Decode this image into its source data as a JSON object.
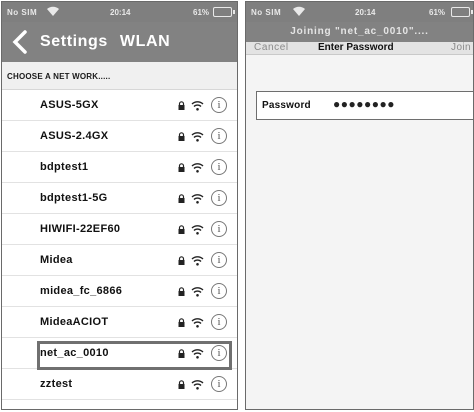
{
  "left_screen": {
    "status_bar": {
      "carrier": "No SIM",
      "time": "20:14",
      "battery": "61%"
    },
    "nav": {
      "back_label": "Settings",
      "title": "WLAN"
    },
    "section_header": "CHOOSE A NET WORK.....",
    "networks": [
      {
        "name": "ASUS-5GX"
      },
      {
        "name": "ASUS-2.4GX"
      },
      {
        "name": "bdptest1"
      },
      {
        "name": "bdptest1-5G"
      },
      {
        "name": "HIWIFI-22EF60"
      },
      {
        "name": "Midea"
      },
      {
        "name": "midea_fc_6866"
      },
      {
        "name": "MideaACIOT"
      },
      {
        "name": "net_ac_0010",
        "selected": true
      },
      {
        "name": "zztest"
      }
    ],
    "info_glyph": "i"
  },
  "right_screen": {
    "status_bar": {
      "carrier": "No SIM",
      "time": "20:14",
      "battery": "61%"
    },
    "joining_title": "Joining \"net_ac_0010\"....",
    "password_bar": {
      "cancel": "Cancel",
      "title": "Enter Password",
      "join": "Join"
    },
    "password_field": {
      "label": "Password",
      "value": "●●●●●●●●"
    }
  },
  "colors": {
    "bar": "#828282",
    "status": "#7f7f7f",
    "highlight": "#707070"
  }
}
